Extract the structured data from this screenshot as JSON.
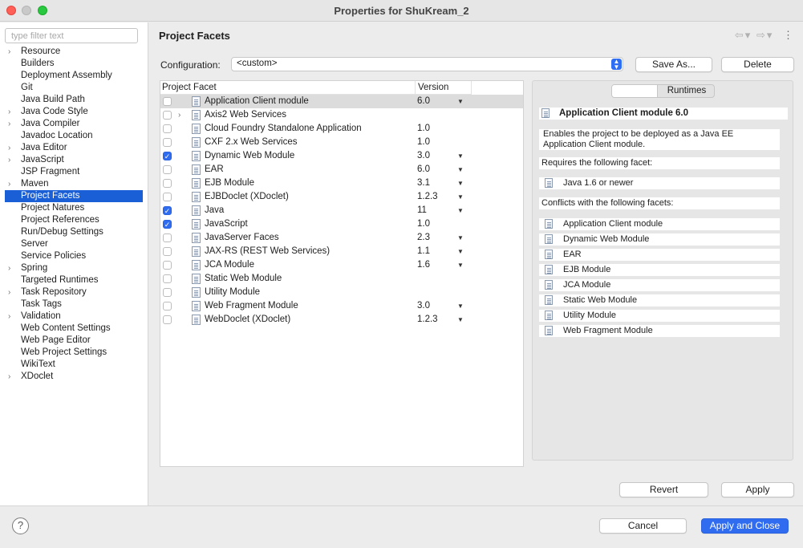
{
  "window": {
    "title": "Properties for ShuKream_2"
  },
  "sidebar": {
    "filter_placeholder": "type filter text",
    "items": [
      {
        "label": "Resource",
        "expandable": true
      },
      {
        "label": "Builders",
        "expandable": false
      },
      {
        "label": "Deployment Assembly",
        "expandable": false
      },
      {
        "label": "Git",
        "expandable": false
      },
      {
        "label": "Java Build Path",
        "expandable": false
      },
      {
        "label": "Java Code Style",
        "expandable": true
      },
      {
        "label": "Java Compiler",
        "expandable": true
      },
      {
        "label": "Javadoc Location",
        "expandable": false
      },
      {
        "label": "Java Editor",
        "expandable": true
      },
      {
        "label": "JavaScript",
        "expandable": true
      },
      {
        "label": "JSP Fragment",
        "expandable": false
      },
      {
        "label": "Maven",
        "expandable": true
      },
      {
        "label": "Project Facets",
        "expandable": false,
        "selected": true
      },
      {
        "label": "Project Natures",
        "expandable": false
      },
      {
        "label": "Project References",
        "expandable": false
      },
      {
        "label": "Run/Debug Settings",
        "expandable": false
      },
      {
        "label": "Server",
        "expandable": false
      },
      {
        "label": "Service Policies",
        "expandable": false
      },
      {
        "label": "Spring",
        "expandable": true
      },
      {
        "label": "Targeted Runtimes",
        "expandable": false
      },
      {
        "label": "Task Repository",
        "expandable": true
      },
      {
        "label": "Task Tags",
        "expandable": false
      },
      {
        "label": "Validation",
        "expandable": true
      },
      {
        "label": "Web Content Settings",
        "expandable": false
      },
      {
        "label": "Web Page Editor",
        "expandable": false
      },
      {
        "label": "Web Project Settings",
        "expandable": false
      },
      {
        "label": "WikiText",
        "expandable": false
      },
      {
        "label": "XDoclet",
        "expandable": true
      }
    ]
  },
  "main": {
    "title": "Project Facets",
    "configuration_label": "Configuration:",
    "configuration_value": "<custom>",
    "save_as_label": "Save As...",
    "delete_label": "Delete",
    "table_headers": {
      "facet": "Project Facet",
      "version": "Version"
    },
    "facets": [
      {
        "name": "Application Client module",
        "version": "6.0",
        "checked": false,
        "dropdown": true,
        "highlighted": true
      },
      {
        "name": "Axis2 Web Services",
        "version": "",
        "checked": false,
        "dropdown": false,
        "expandable": true
      },
      {
        "name": "Cloud Foundry Standalone Application",
        "version": "1.0",
        "checked": false,
        "dropdown": false
      },
      {
        "name": "CXF 2.x Web Services",
        "version": "1.0",
        "checked": false,
        "dropdown": false
      },
      {
        "name": "Dynamic Web Module",
        "version": "3.0",
        "checked": true,
        "dropdown": true
      },
      {
        "name": "EAR",
        "version": "6.0",
        "checked": false,
        "dropdown": true
      },
      {
        "name": "EJB Module",
        "version": "3.1",
        "checked": false,
        "dropdown": true
      },
      {
        "name": "EJBDoclet (XDoclet)",
        "version": "1.2.3",
        "checked": false,
        "dropdown": true
      },
      {
        "name": "Java",
        "version": "11",
        "checked": true,
        "dropdown": true
      },
      {
        "name": "JavaScript",
        "version": "1.0",
        "checked": true,
        "dropdown": false
      },
      {
        "name": "JavaServer Faces",
        "version": "2.3",
        "checked": false,
        "dropdown": true
      },
      {
        "name": "JAX-RS (REST Web Services)",
        "version": "1.1",
        "checked": false,
        "dropdown": true
      },
      {
        "name": "JCA Module",
        "version": "1.6",
        "checked": false,
        "dropdown": true
      },
      {
        "name": "Static Web Module",
        "version": "",
        "checked": false,
        "dropdown": false
      },
      {
        "name": "Utility Module",
        "version": "",
        "checked": false,
        "dropdown": false
      },
      {
        "name": "Web Fragment Module",
        "version": "3.0",
        "checked": false,
        "dropdown": true
      },
      {
        "name": "WebDoclet (XDoclet)",
        "version": "1.2.3",
        "checked": false,
        "dropdown": true
      }
    ],
    "details": {
      "tab_blank": "",
      "tab_runtimes": "Runtimes",
      "heading": "Application Client module 6.0",
      "description": "Enables the project to be deployed as a Java EE Application Client module.",
      "requires_label": "Requires the following facet:",
      "requires": [
        "Java 1.6 or newer"
      ],
      "conflicts_label": "Conflicts with the following facets:",
      "conflicts": [
        "Application Client module",
        "Dynamic Web Module",
        "EAR",
        "EJB Module",
        "JCA Module",
        "Static Web Module",
        "Utility Module",
        "Web Fragment Module"
      ]
    },
    "revert_label": "Revert",
    "apply_label": "Apply"
  },
  "footer": {
    "help": "?",
    "cancel_label": "Cancel",
    "apply_close_label": "Apply and Close"
  },
  "colors": {
    "selection": "#1a5fd6",
    "primary_button": "#2f6cf0",
    "checkbox_on": "#2f6cf0"
  }
}
